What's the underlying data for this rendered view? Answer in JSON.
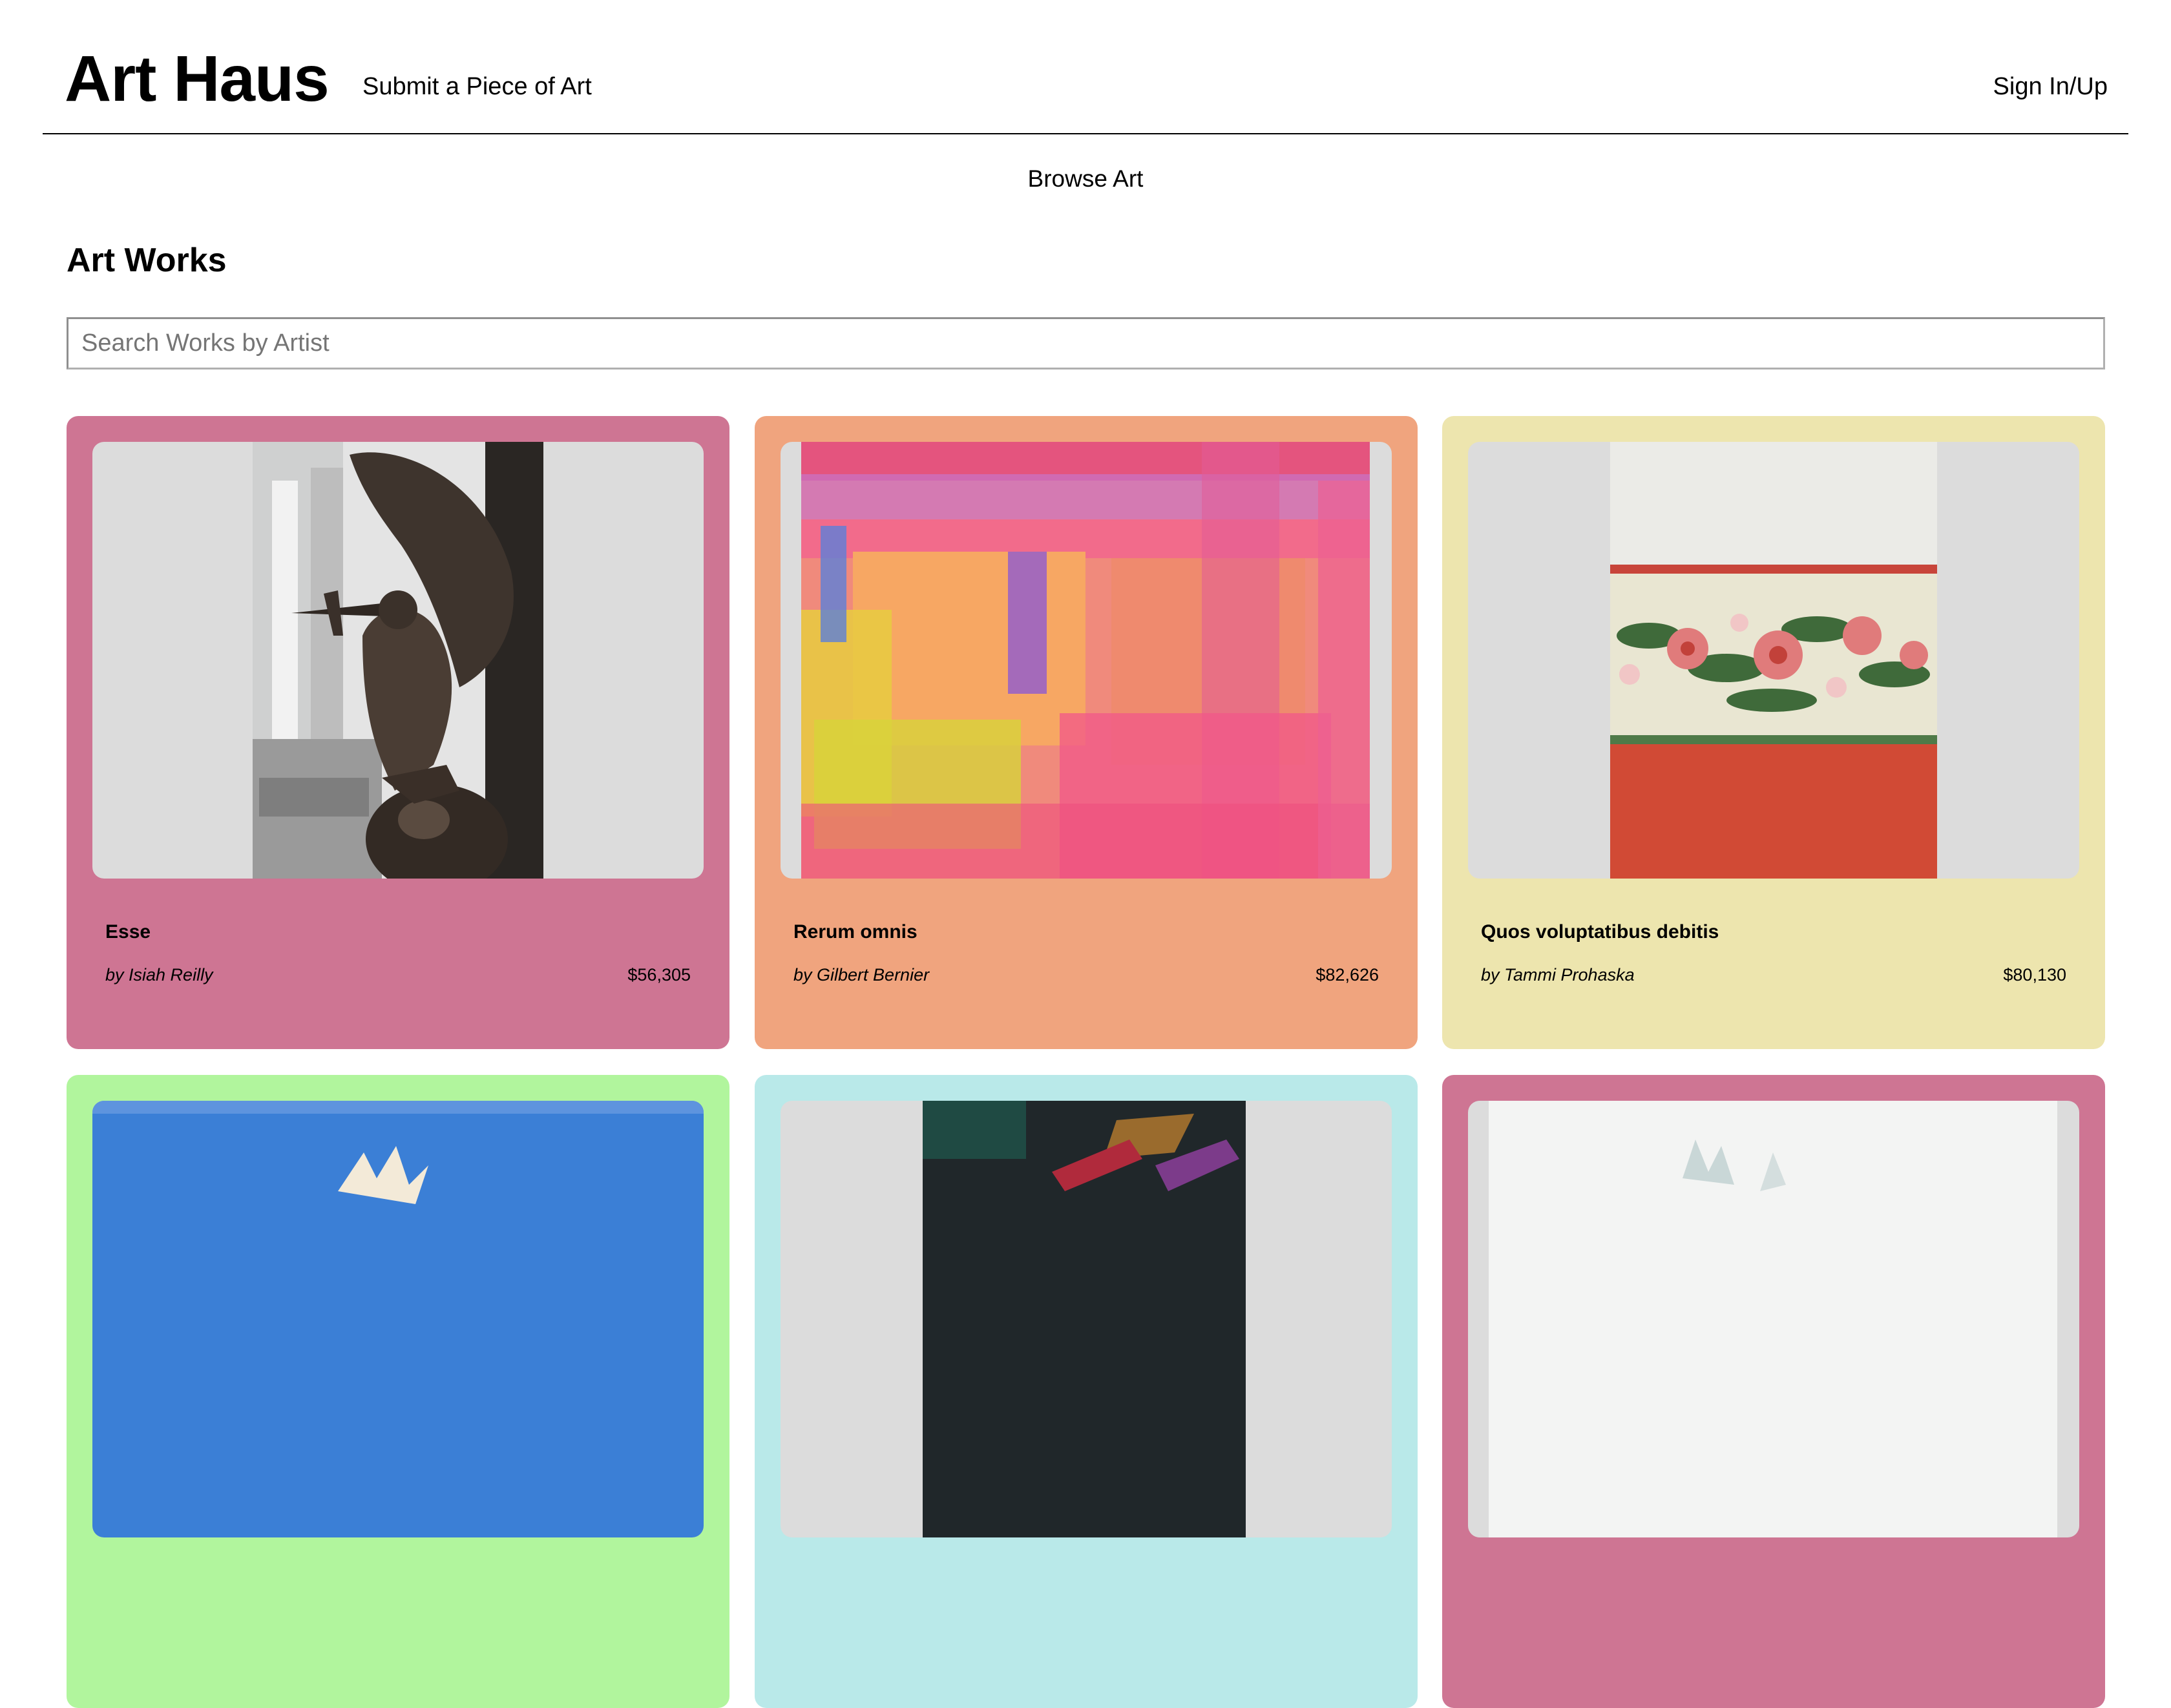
{
  "header": {
    "brand": "Art Haus",
    "submit_label": "Submit a Piece of Art",
    "signin_label": "Sign In/Up"
  },
  "subnav": {
    "browse_label": "Browse Art"
  },
  "main": {
    "section_title": "Art Works",
    "search_placeholder": "Search Works by Artist"
  },
  "cards": [
    {
      "title": "Esse",
      "artist": "by Isiah Reilly",
      "price": "$56,305",
      "bg": "#ce7593",
      "artwork": "winged-bronze-sculpture"
    },
    {
      "title": "Rerum omnis",
      "artist": "by Gilbert Bernier",
      "price": "$82,626",
      "bg": "#f0a47e",
      "artwork": "pink-orange-abstract-painting"
    },
    {
      "title": "Quos voluptatibus debitis",
      "artist": "by Tammi Prohaska",
      "price": "$80,130",
      "bg": "#ede5ae",
      "artwork": "floral-wallpaper-border"
    },
    {
      "title": "",
      "artist": "",
      "price": "",
      "bg": "#b1f59d",
      "artwork": "blue-sky-doves"
    },
    {
      "title": "",
      "artist": "",
      "price": "",
      "bg": "#b9e9e9",
      "artwork": "dark-textured-abstract"
    },
    {
      "title": "",
      "artist": "",
      "price": "",
      "bg": "#ce7593",
      "artwork": "pale-sculpture-photo"
    }
  ]
}
